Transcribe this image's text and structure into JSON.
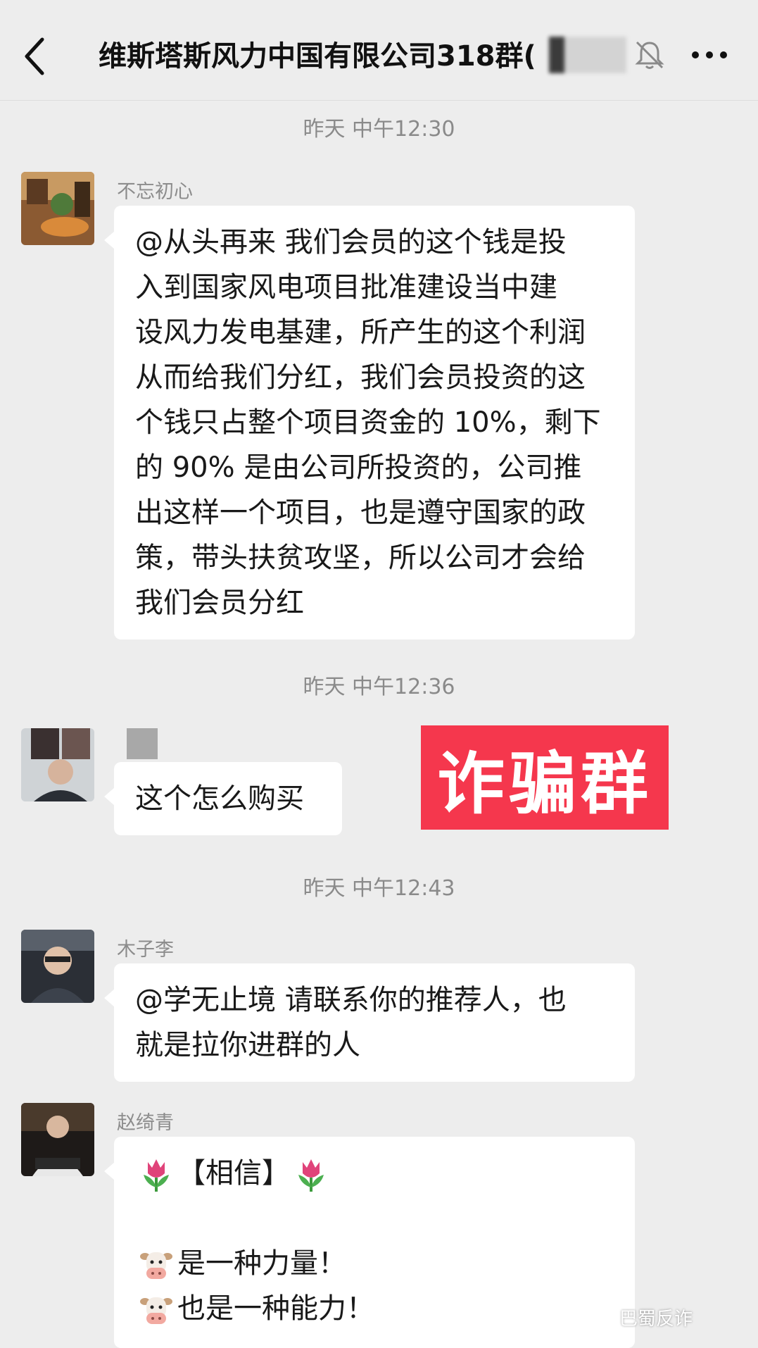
{
  "header": {
    "title": "维斯塔斯风力中国有限公司318群("
  },
  "messages": [
    {
      "timestamp": "昨天 中午12:30",
      "sender": "不忘初心",
      "lines": [
        "@从头再来  我们会员的这个钱是投",
        "入到国家风电项目批准建设当中建",
        "设风力发电基建，所产生的这个利润",
        "从而给我们分红，我们会员投资的这",
        "个钱只占整个项目资金的 10%，剩下",
        "的 90% 是由公司所投资的，公司推",
        "出这样一个项目，也是遵守国家的政",
        "策，带头扶贫攻坚，所以公司才会给",
        "我们会员分红"
      ]
    },
    {
      "timestamp": "昨天 中午12:36",
      "sender": "",
      "lines": [
        "这个怎么购买"
      ]
    },
    {
      "timestamp": "昨天 中午12:43",
      "sender": "木子李",
      "lines": [
        "@学无止境  请联系你的推荐人，也",
        "就是拉你进群的人"
      ]
    },
    {
      "timestamp": "",
      "sender": "赵绮青",
      "lines": [
        "【相信】",
        "",
        "是一种力量！",
        "也是一种能力！"
      ]
    }
  ],
  "overlay": {
    "label": "诈骗群"
  },
  "watermark": {
    "text": "巴蜀反诈"
  },
  "colors": {
    "background": "#ededed",
    "bubble": "#ffffff",
    "overlay": "#f5374d",
    "timestamp": "#8a8a8a"
  },
  "icons": [
    "back-icon",
    "mute-bell-icon",
    "more-icon",
    "tulip-emoji",
    "cow-emoji",
    "wechat-icon"
  ]
}
